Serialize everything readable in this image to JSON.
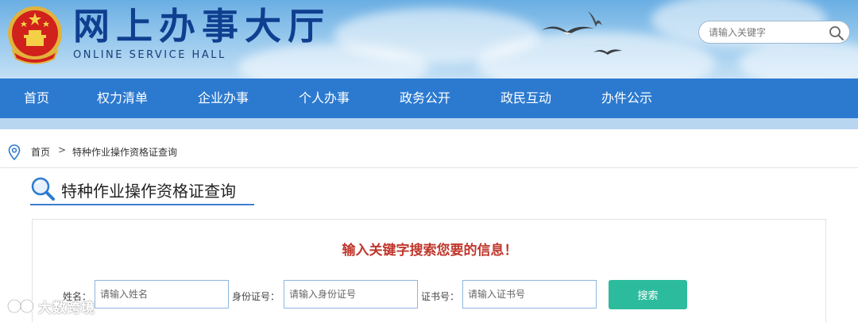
{
  "header": {
    "title": "网上办事大厅",
    "subtitle": "ONLINE SERVICE HALL",
    "search_placeholder": "请输入关键字"
  },
  "nav": {
    "items": [
      "首页",
      "权力清单",
      "企业办事",
      "个人办事",
      "政务公开",
      "政民互动",
      "办件公示"
    ]
  },
  "breadcrumb": {
    "home": "首页",
    "separator": ">",
    "current": "特种作业操作资格证查询"
  },
  "page": {
    "title": "特种作业操作资格证查询"
  },
  "search_form": {
    "heading": "输入关键字搜索您要的信息！",
    "name_label": "姓名：",
    "name_placeholder": "请输入姓名",
    "id_label": "身份证号：",
    "id_placeholder": "请输入身份证号",
    "cert_label": "证书号：",
    "cert_placeholder": "请输入证书号",
    "submit_label": "搜索"
  },
  "watermark": {
    "text": "大数跨境"
  },
  "colors": {
    "nav_background": "#2c7ad0",
    "title_text": "#0f3f8f",
    "heading_red": "#c0372d",
    "submit_green": "#2dbb9d"
  },
  "icons": {
    "emblem": "national-emblem-icon",
    "search": "search-icon",
    "location": "location-pin-icon",
    "magnifier": "magnifier-icon",
    "watermark_logo": "watermark-logo-icon"
  }
}
